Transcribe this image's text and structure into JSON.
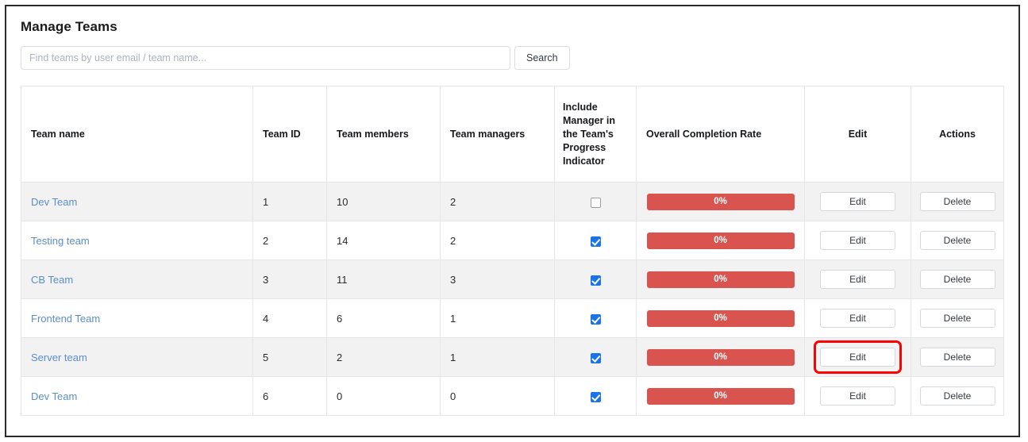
{
  "page": {
    "title": "Manage Teams"
  },
  "search": {
    "placeholder": "Find teams by user email / team name...",
    "value": "",
    "button_label": "Search"
  },
  "table": {
    "headers": {
      "team_name": "Team name",
      "team_id": "Team ID",
      "team_members": "Team members",
      "team_managers": "Team managers",
      "include_manager": "Include Manager in the Team's Progress Indicator",
      "completion_rate": "Overall Completion Rate",
      "edit": "Edit",
      "actions": "Actions"
    },
    "rows": [
      {
        "team_name": "Dev Team",
        "team_id": "1",
        "team_members": "10",
        "team_managers": "2",
        "include_manager_checked": false,
        "completion_rate": "0%",
        "completion_percent": 0,
        "edit_label": "Edit",
        "delete_label": "Delete",
        "edit_highlighted": false
      },
      {
        "team_name": "Testing team",
        "team_id": "2",
        "team_members": "14",
        "team_managers": "2",
        "include_manager_checked": true,
        "completion_rate": "0%",
        "completion_percent": 0,
        "edit_label": "Edit",
        "delete_label": "Delete",
        "edit_highlighted": false
      },
      {
        "team_name": "CB Team",
        "team_id": "3",
        "team_members": "11",
        "team_managers": "3",
        "include_manager_checked": true,
        "completion_rate": "0%",
        "completion_percent": 0,
        "edit_label": "Edit",
        "delete_label": "Delete",
        "edit_highlighted": false
      },
      {
        "team_name": "Frontend Team",
        "team_id": "4",
        "team_members": "6",
        "team_managers": "1",
        "include_manager_checked": true,
        "completion_rate": "0%",
        "completion_percent": 0,
        "edit_label": "Edit",
        "delete_label": "Delete",
        "edit_highlighted": false
      },
      {
        "team_name": "Server team",
        "team_id": "5",
        "team_members": "2",
        "team_managers": "1",
        "include_manager_checked": true,
        "completion_rate": "0%",
        "completion_percent": 0,
        "edit_label": "Edit",
        "delete_label": "Delete",
        "edit_highlighted": true
      },
      {
        "team_name": "Dev Team",
        "team_id": "6",
        "team_members": "0",
        "team_managers": "0",
        "include_manager_checked": true,
        "completion_rate": "0%",
        "completion_percent": 0,
        "edit_label": "Edit",
        "delete_label": "Delete",
        "edit_highlighted": false
      }
    ]
  },
  "colors": {
    "link": "#5b8ec9",
    "progress_bar": "#d9534f",
    "checkbox_checked": "#1a73e8",
    "highlight_ring": "#ff0000",
    "row_stripe": "#f2f2f2"
  }
}
